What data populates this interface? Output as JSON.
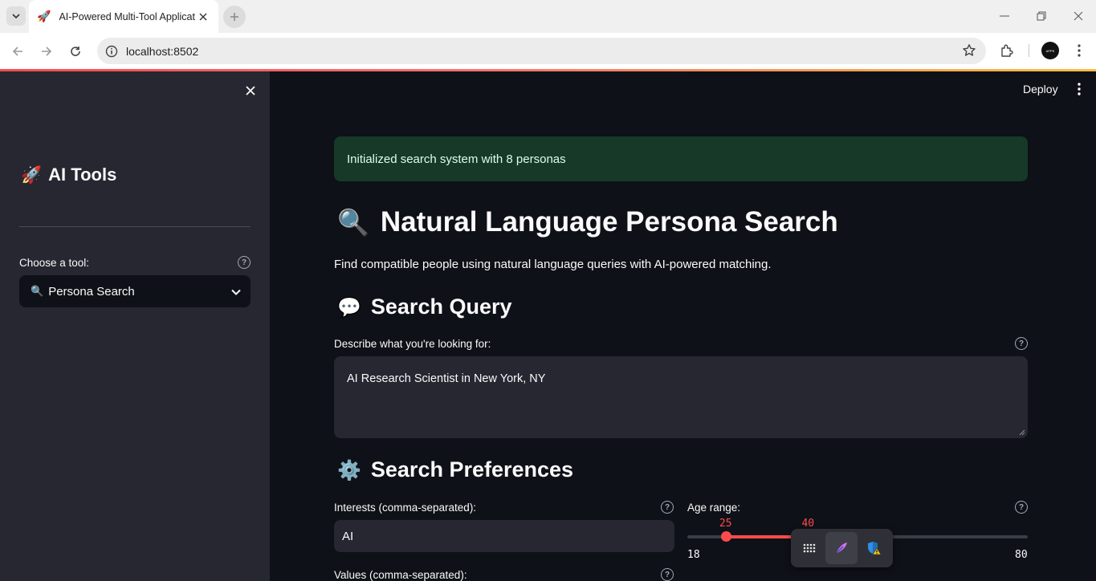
{
  "browser": {
    "tab_title": "AI-Powered Multi-Tool Applicat",
    "tab_favicon": "🚀",
    "url": "localhost:8502",
    "profile_text": "APPS"
  },
  "sidebar": {
    "title_emoji": "🚀",
    "title": "AI Tools",
    "tool_label": "Choose a tool:",
    "tool_select": {
      "emoji": "🔍",
      "value": "Persona Search"
    }
  },
  "header": {
    "deploy_label": "Deploy"
  },
  "main": {
    "status_message": "Initialized search system with 8 personas",
    "title_emoji": "🔍",
    "title": "Natural Language Persona Search",
    "subtitle": "Find compatible people using natural language queries with AI-powered matching.",
    "query_section": {
      "emoji": "💬",
      "heading": "Search Query",
      "label": "Describe what you're looking for:",
      "value": "AI Research Scientist in New York, NY"
    },
    "prefs_section": {
      "emoji": "⚙️",
      "heading": "Search Preferences",
      "interests_label": "Interests (comma-separated):",
      "interests_value": "AI",
      "values_label": "Values (comma-separated):",
      "age_label": "Age range:",
      "age_min": 18,
      "age_max": 80,
      "age_low": 25,
      "age_high": 40
    }
  },
  "colors": {
    "accent": "#ff4b4b",
    "success_bg": "#173928",
    "sidebar_bg": "#262730",
    "main_bg": "#0e1117"
  },
  "icons": {
    "floating_toolbar": [
      "grid-icon",
      "feather-pen-icon",
      "shield-warning-icon"
    ]
  }
}
